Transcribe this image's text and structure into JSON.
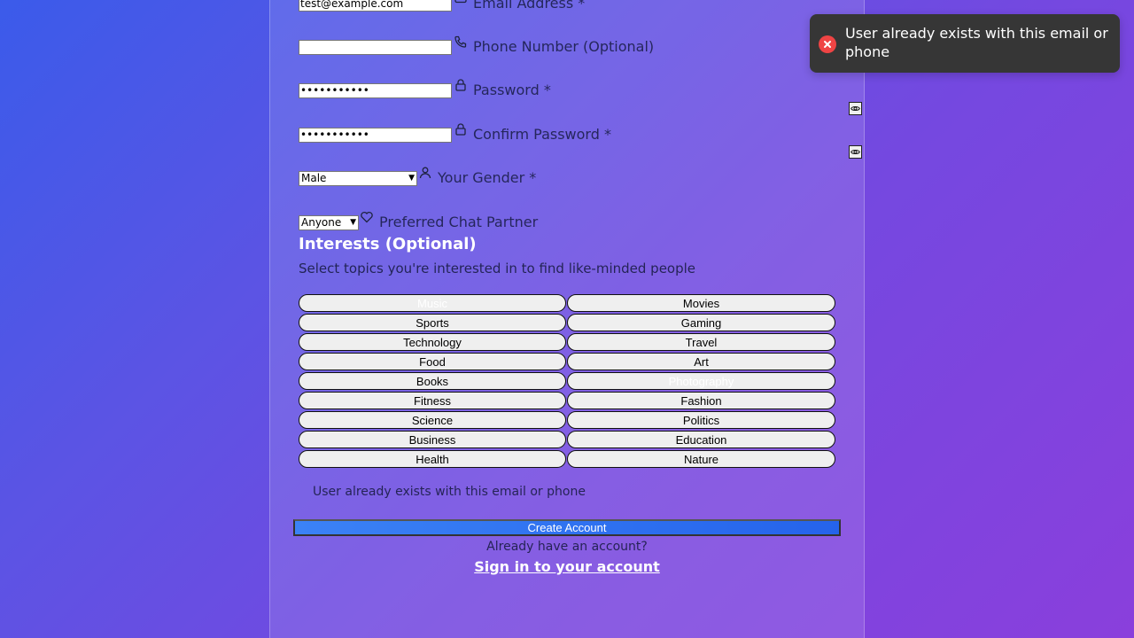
{
  "form": {
    "email": {
      "value": "test@example.com",
      "label": "Email Address *",
      "icon": "mail-icon"
    },
    "phone": {
      "value": "",
      "label": "Phone Number (Optional)",
      "icon": "phone-icon"
    },
    "password": {
      "value": "•••••••••••",
      "label": "Password *",
      "icon": "lock-icon"
    },
    "confirm_password": {
      "value": "•••••••••••",
      "label": "Confirm Password *",
      "icon": "lock-icon"
    },
    "gender": {
      "value": "Male",
      "label": "Your Gender *",
      "icon": "user-icon"
    },
    "partner": {
      "value": "Anyone",
      "label": "Preferred Chat Partner",
      "icon": "heart-icon"
    }
  },
  "interests": {
    "title": "Interests (Optional)",
    "subtitle": "Select topics you're interested in to find like-minded people",
    "items": [
      {
        "label": "Music",
        "selected": true
      },
      {
        "label": "Movies",
        "selected": false
      },
      {
        "label": "Sports",
        "selected": false
      },
      {
        "label": "Gaming",
        "selected": false
      },
      {
        "label": "Technology",
        "selected": false
      },
      {
        "label": "Travel",
        "selected": false
      },
      {
        "label": "Food",
        "selected": false
      },
      {
        "label": "Art",
        "selected": false
      },
      {
        "label": "Books",
        "selected": false
      },
      {
        "label": "Photography",
        "selected": true
      },
      {
        "label": "Fitness",
        "selected": false
      },
      {
        "label": "Fashion",
        "selected": false
      },
      {
        "label": "Science",
        "selected": false
      },
      {
        "label": "Politics",
        "selected": false
      },
      {
        "label": "Business",
        "selected": false
      },
      {
        "label": "Education",
        "selected": false
      },
      {
        "label": "Health",
        "selected": false
      },
      {
        "label": "Nature",
        "selected": false
      }
    ]
  },
  "error_message": "User already exists with this email or phone",
  "submit_label": "Create Account",
  "footer": {
    "prompt": "Already have an account?",
    "signin_link": "Sign in to your account"
  },
  "toast": {
    "message": "User already exists with this email or phone",
    "icon": "error-x-icon",
    "color": "#ef4444"
  }
}
